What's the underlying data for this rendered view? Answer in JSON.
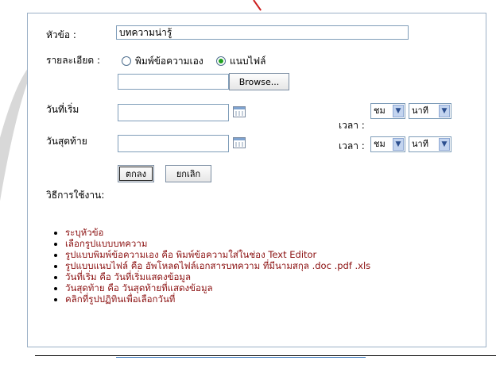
{
  "form": {
    "topic_label": "หัวข้อ :",
    "topic_value": "บทความน่ารู้",
    "detail_label": "รายละเอียด :",
    "radio_type": "พิมพ์ข้อความเอง",
    "radio_file": "แนบไฟล์",
    "browse_label": "Browse...",
    "start_label": "วันที่เริ่ม",
    "end_label": "วันสุดท้าย",
    "time_label": "เวลา :",
    "hour_option": "ชม",
    "minute_option": "นาที",
    "ok_label": "ตกลง",
    "cancel_label": "ยกเลิก"
  },
  "help": {
    "title": "วิธีการใช้งาน:",
    "items": [
      "ระบุหัวข้อ",
      "เลือกรูปแบบบทความ",
      "รูปแบบพิมพ์ข้อความเอง คือ พิมพ์ข้อความใส่ในช่อง Text Editor",
      "รูปแบบแนบไฟล์ คือ อัพโหลดไฟล์เอกสารบทความ ที่มีนามสกุล .doc .pdf .xls",
      "วันที่เริ่ม คือ วันที่เริ่มแสดงข้อมูล",
      "วันสุดท้าย คือ วันสุดท้ายที่แสดงข้อมูล",
      "คลิกที่รูปปฏิทินเพื่อเลือกวันที่"
    ]
  },
  "colors": {
    "help_text": "#8b1010",
    "border": "#9bb0c6",
    "radio_selected": "#21a121"
  }
}
